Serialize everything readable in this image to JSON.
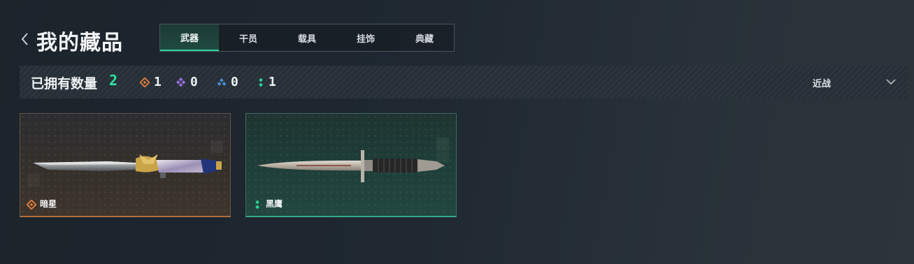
{
  "header": {
    "title": "我的藏品",
    "tabs": [
      {
        "label": "武器",
        "active": true
      },
      {
        "label": "干员",
        "active": false
      },
      {
        "label": "载具",
        "active": false
      },
      {
        "label": "挂饰",
        "active": false
      },
      {
        "label": "典藏",
        "active": false
      }
    ]
  },
  "stats": {
    "owned_label": "已拥有数量",
    "owned_count": "2",
    "rarities": [
      {
        "icon": "orange-diamond-icon",
        "color": "#d77b3f",
        "count": "1"
      },
      {
        "icon": "purple-diamond-icon",
        "color": "#9a6ee0",
        "count": "0"
      },
      {
        "icon": "blue-diamond-icon",
        "color": "#4b8fd6",
        "count": "0"
      },
      {
        "icon": "green-dots-icon",
        "color": "#2fd39a",
        "count": "1"
      }
    ],
    "filter_label": "近战"
  },
  "items": [
    {
      "name": "暗星",
      "rarity_color": "#d77b3f",
      "rarity_icon": "orange-diamond-icon"
    },
    {
      "name": "黑鹰",
      "rarity_color": "#2fd39a",
      "rarity_icon": "green-dots-icon"
    }
  ],
  "colors": {
    "accent": "#2fe3a0"
  }
}
